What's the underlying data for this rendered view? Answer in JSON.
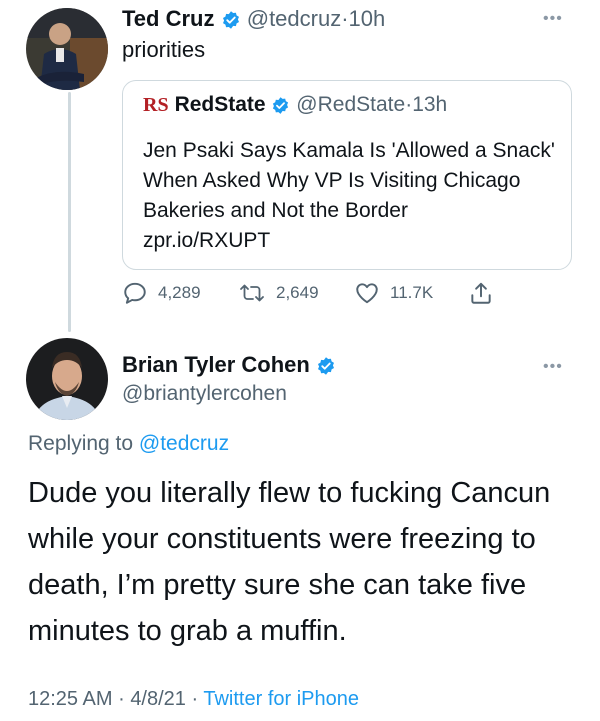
{
  "tweet": {
    "author_name": "Ted Cruz",
    "author_handle": "@tedcruz",
    "time": "10h",
    "text": "priorities",
    "quoted": {
      "logo": "RS",
      "author_name": "RedState",
      "author_handle": "@RedState",
      "time": "13h",
      "text": "Jen Psaki Says Kamala Is 'Allowed a Snack' When Asked Why VP Is Visiting Chicago Bakeries and Not the Border",
      "link": "zpr.io/RXUPT"
    },
    "actions": {
      "replies": "4,289",
      "retweets": "2,649",
      "likes": "11.7K"
    }
  },
  "reply": {
    "author_name": "Brian Tyler Cohen",
    "author_handle": "@briantylercohen",
    "replying_label": "Replying to",
    "replying_to": "@tedcruz",
    "text": "Dude you literally flew to fucking Cancun while your constituents were freezing to death, I’m pretty sure she can take five minutes to grab a muffin.",
    "time": "12:25 AM",
    "date": "4/8/21",
    "source": "Twitter for iPhone"
  },
  "separator": "·",
  "icons": {
    "verified": "verified-badge-icon",
    "more": "more-dots-icon",
    "reply": "reply-icon",
    "retweet": "retweet-icon",
    "like": "heart-icon",
    "share": "share-icon"
  },
  "colors": {
    "accent": "#1d9bf0",
    "secondary_text": "#536471",
    "border": "#cfd9de",
    "redstate": "#b32025"
  }
}
